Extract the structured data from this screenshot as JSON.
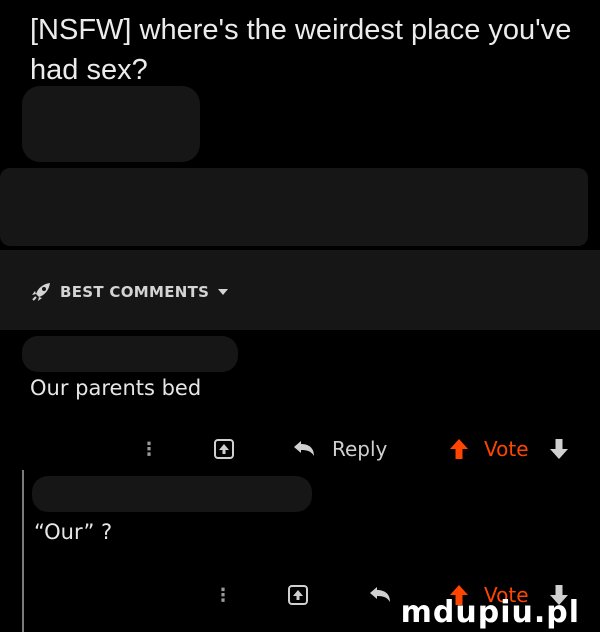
{
  "post": {
    "title": "[NSFW] where's the weirdest place you've had sex?"
  },
  "sort": {
    "label": "BEST COMMENTS",
    "icon": "rocket-icon",
    "dropdown_icon": "chevron-down-icon"
  },
  "comments": [
    {
      "text": "Our parents bed",
      "actions": {
        "reply_label": "Reply",
        "vote_label": "Vote"
      }
    },
    {
      "text": "“Our” ?",
      "actions": {
        "reply_label": "",
        "vote_label": "Vote"
      }
    }
  ],
  "colors": {
    "background": "#000000",
    "accent": "#ff4500",
    "text": "#ececec",
    "redaction": "#161616"
  },
  "watermark": "mdupiu.pl"
}
